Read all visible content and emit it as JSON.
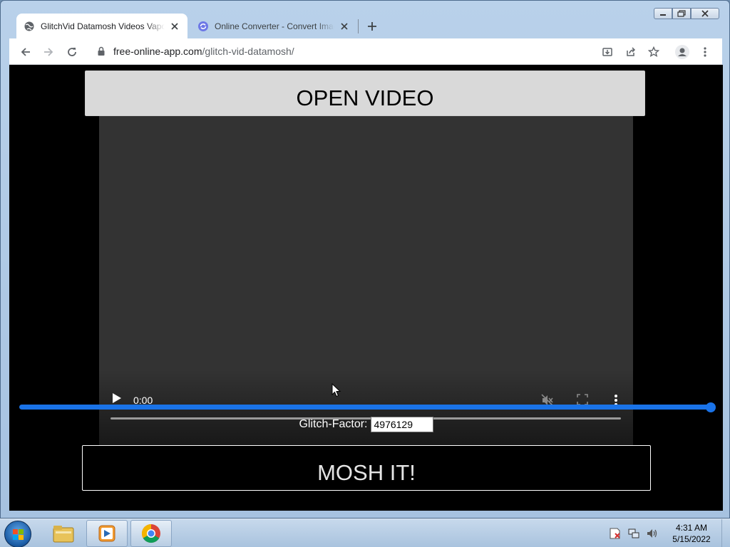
{
  "browser": {
    "tabs": [
      {
        "title": "GlitchVid Datamosh Videos Vapo",
        "active": true,
        "icon": "globe-icon"
      },
      {
        "title": "Online Converter - Convert Imag",
        "active": false,
        "icon": "converter-icon"
      }
    ],
    "url_host": "free-online-app.com",
    "url_path": "/glitch-vid-datamosh/"
  },
  "page": {
    "open_video_label": "OPEN VIDEO",
    "video": {
      "time": "0:00",
      "muted": true
    },
    "slider_value_fraction": 1.0,
    "glitch_label": "Glitch-Factor:",
    "glitch_value": "4976129",
    "mosh_label": "MOSH IT!"
  },
  "taskbar": {
    "apps": [
      "file-explorer-icon",
      "media-player-icon",
      "chrome-icon"
    ],
    "time": "4:31 AM",
    "date": "5/15/2022"
  },
  "colors": {
    "slider": "#1a73e8",
    "page_bg": "#000000",
    "open_button_bg": "#d9d9d9"
  }
}
